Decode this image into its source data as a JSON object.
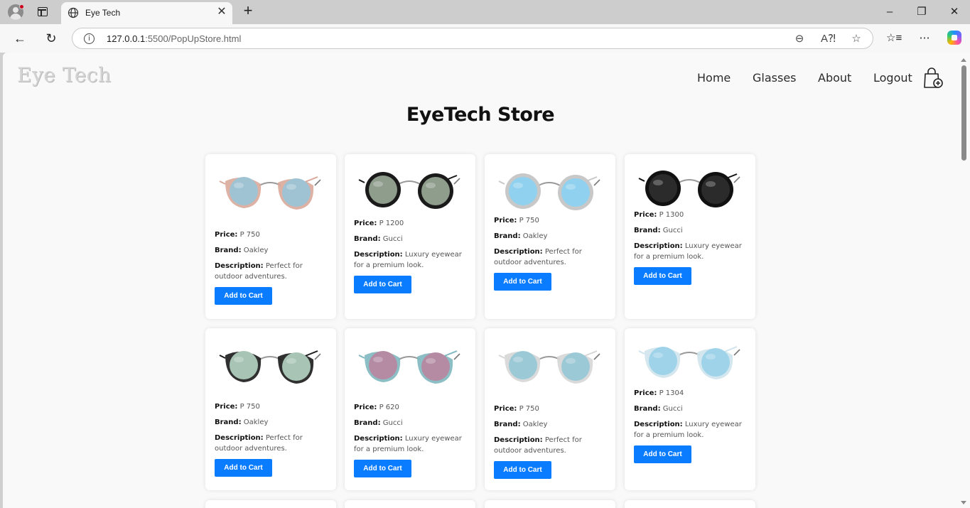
{
  "browser": {
    "tab_title": "Eye Tech",
    "url_host": "127.0.0.1",
    "url_rest": ":5500/PopUpStore.html",
    "new_tab": "+",
    "tab_close": "✕"
  },
  "page": {
    "logo": "Eye Tech",
    "nav": [
      "Home",
      "Glasses",
      "About",
      "Logout"
    ],
    "store_title": "EyeTech Store"
  },
  "products": [
    {
      "price": "P 750",
      "brand": "Oakley",
      "description": "Perfect for outdoor adventures.",
      "button": "Add to Cart",
      "frame": "#d9a89a",
      "lens": "#9fc3d3",
      "style": "cat"
    },
    {
      "price": "P 1200",
      "brand": "Gucci",
      "description": "Luxury eyewear for a premium look.",
      "button": "Add to Cart",
      "frame": "#1a1a1a",
      "lens": "#8f9d8c",
      "style": "round"
    },
    {
      "price": "P 750",
      "brand": "Oakley",
      "description": "Perfect for outdoor adventures.",
      "button": "Add to Cart",
      "frame": "#c8c8c8",
      "lens": "#8fd1ee",
      "style": "round"
    },
    {
      "price": "P 1300",
      "brand": "Gucci",
      "description": "Luxury eyewear for a premium look.",
      "button": "Add to Cart",
      "frame": "#111111",
      "lens": "#2b2b2b",
      "style": "round"
    },
    {
      "price": "P 750",
      "brand": "Oakley",
      "description": "Perfect for outdoor adventures.",
      "button": "Add to Cart",
      "frame": "#1a1a1a",
      "lens": "#a7c4b4",
      "style": "cat"
    },
    {
      "price": "P 620",
      "brand": "Gucci",
      "description": "Luxury eyewear for a premium look.",
      "button": "Add to Cart",
      "frame": "#7fb8bf",
      "lens": "#b58aa3",
      "style": "cat"
    },
    {
      "price": "P 750",
      "brand": "Oakley",
      "description": "Perfect for outdoor adventures.",
      "button": "Add to Cart",
      "frame": "#d6d6d6",
      "lens": "#9cc9d6",
      "style": "cat"
    },
    {
      "price": "P 1304",
      "brand": "Gucci",
      "description": "Luxury eyewear for a premium look.",
      "button": "Add to Cart",
      "frame": "#cfe3ec",
      "lens": "#9ed3ea",
      "style": "cat"
    }
  ],
  "labels": {
    "price": "Price:",
    "brand": "Brand:",
    "description": "Description:"
  },
  "colors": {
    "button": "#0a7cff",
    "page_bg": "#f9f9f9",
    "card_bg": "#ffffff"
  }
}
